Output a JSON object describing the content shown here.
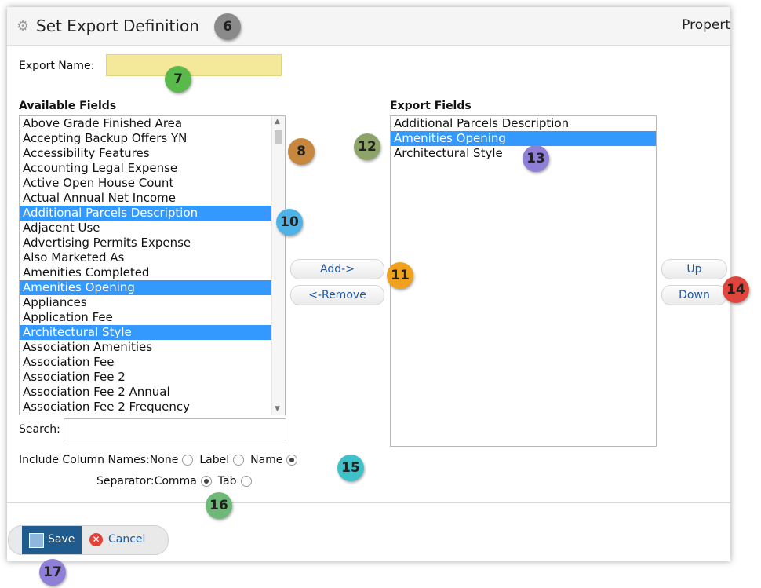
{
  "header": {
    "title": "Set Export Definition",
    "right_text": "Propert"
  },
  "export_name": {
    "label": "Export Name:",
    "value": ""
  },
  "available": {
    "heading": "Available Fields",
    "items": [
      {
        "label": "Above Grade Finished Area",
        "selected": false
      },
      {
        "label": "Accepting Backup Offers YN",
        "selected": false
      },
      {
        "label": "Accessibility Features",
        "selected": false
      },
      {
        "label": "Accounting Legal Expense",
        "selected": false
      },
      {
        "label": "Active Open House Count",
        "selected": false
      },
      {
        "label": "Actual Annual Net Income",
        "selected": false
      },
      {
        "label": "Additional Parcels Description",
        "selected": true
      },
      {
        "label": "Adjacent Use",
        "selected": false
      },
      {
        "label": "Advertising Permits Expense",
        "selected": false
      },
      {
        "label": "Also Marketed As",
        "selected": false
      },
      {
        "label": "Amenities Completed",
        "selected": false
      },
      {
        "label": "Amenities Opening",
        "selected": true
      },
      {
        "label": "Appliances",
        "selected": false
      },
      {
        "label": "Application Fee",
        "selected": false
      },
      {
        "label": "Architectural Style",
        "selected": true
      },
      {
        "label": "Association Amenities",
        "selected": false
      },
      {
        "label": "Association Fee",
        "selected": false
      },
      {
        "label": "Association Fee 2",
        "selected": false
      },
      {
        "label": "Association Fee 2 Annual",
        "selected": false
      },
      {
        "label": "Association Fee 2 Frequency",
        "selected": false
      }
    ]
  },
  "export_fields": {
    "heading": "Export Fields",
    "items": [
      {
        "label": "Additional Parcels Description",
        "selected": false
      },
      {
        "label": "Amenities Opening",
        "selected": true
      },
      {
        "label": "Architectural Style",
        "selected": false
      }
    ]
  },
  "buttons": {
    "add": "Add->",
    "remove": "<-Remove",
    "up": "Up",
    "down": "Down",
    "save": "Save",
    "cancel": "Cancel"
  },
  "search": {
    "label": "Search:",
    "value": ""
  },
  "include_column_names": {
    "label": "Include Column Names:",
    "options": [
      {
        "label": "None",
        "checked": false
      },
      {
        "label": "Label",
        "checked": false
      },
      {
        "label": "Name",
        "checked": true
      }
    ]
  },
  "separator": {
    "label": "Separator:",
    "options": [
      {
        "label": "Comma",
        "checked": true
      },
      {
        "label": "Tab",
        "checked": false
      }
    ]
  },
  "callouts": [
    {
      "number": "6",
      "color": "#8a8a8a"
    },
    {
      "number": "7",
      "color": "#59b94a"
    },
    {
      "number": "8",
      "color": "#c8873e"
    },
    {
      "number": "10",
      "color": "#4fb3e8"
    },
    {
      "number": "11",
      "color": "#f0a21c"
    },
    {
      "number": "12",
      "color": "#8ea36a"
    },
    {
      "number": "13",
      "color": "#8f7fd6"
    },
    {
      "number": "14",
      "color": "#e0453d"
    },
    {
      "number": "15",
      "color": "#3ec1c9"
    },
    {
      "number": "16",
      "color": "#6fb978"
    },
    {
      "number": "17",
      "color": "#8f7fd6"
    }
  ],
  "colors": {
    "selection": "#3399ff",
    "export_name_bg": "#f4e89a",
    "save_bg": "#1f5b8c",
    "link": "#1a57a5"
  }
}
